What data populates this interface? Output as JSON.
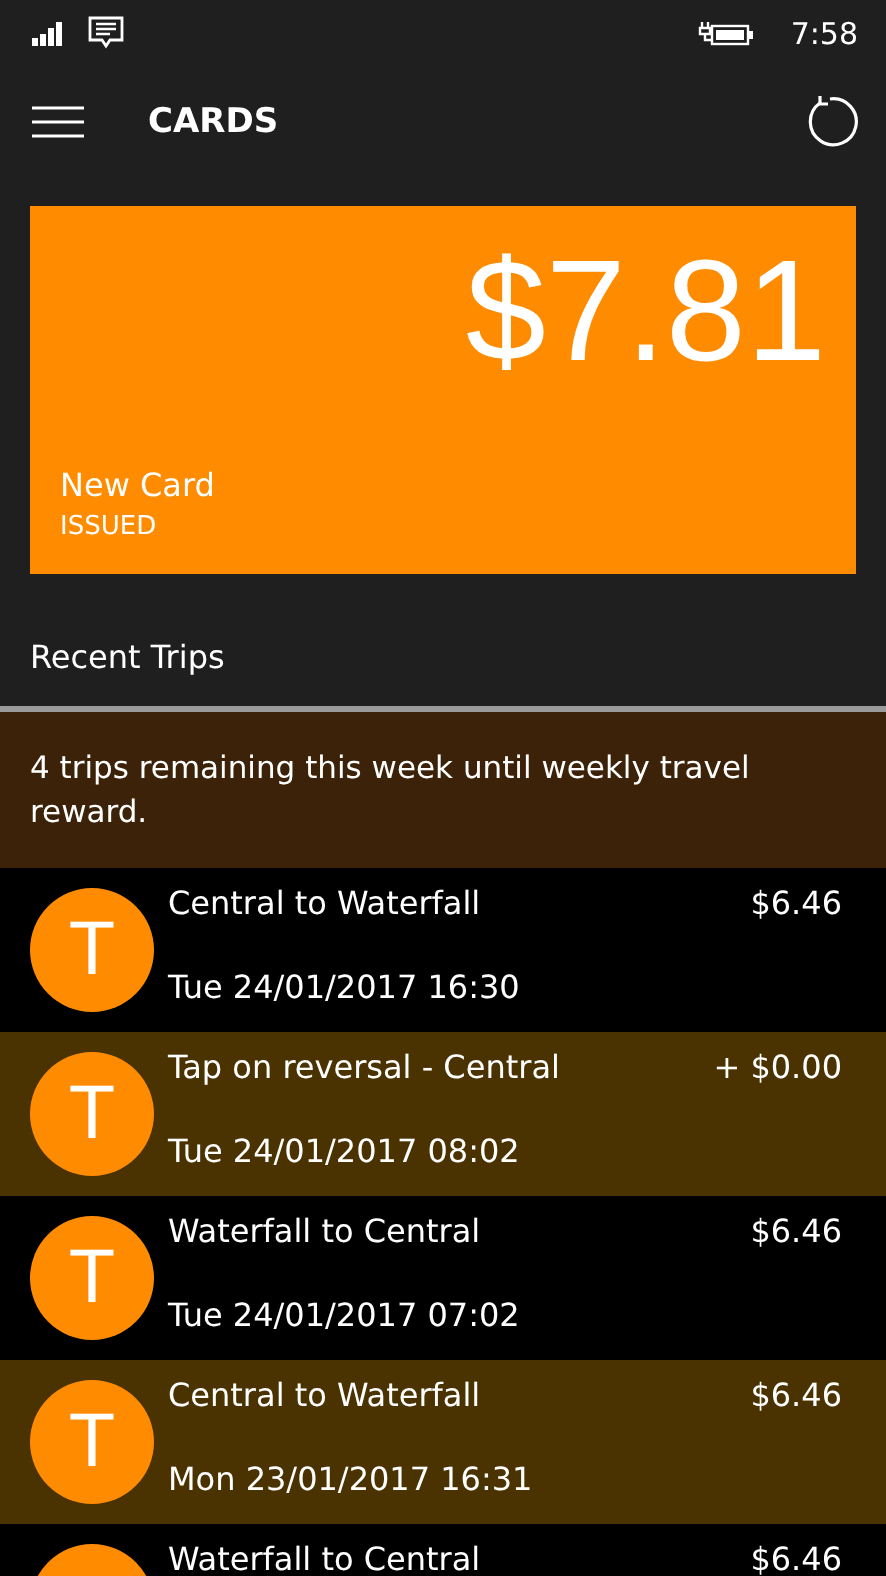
{
  "status_bar": {
    "time": "7:58"
  },
  "header": {
    "title": "CARDS"
  },
  "card": {
    "balance": "$7.81",
    "name": "New Card",
    "status": "ISSUED"
  },
  "section_title": "Recent Trips",
  "reward_banner": "4 trips remaining this week until weekly travel reward.",
  "trips": [
    {
      "avatar": "T",
      "title": "Central to Waterfall",
      "amount": "$6.46",
      "time": "Tue 24/01/2017 16:30"
    },
    {
      "avatar": "T",
      "title": "Tap on reversal - Central",
      "amount": "+ $0.00",
      "time": "Tue 24/01/2017 08:02"
    },
    {
      "avatar": "T",
      "title": "Waterfall to Central",
      "amount": "$6.46",
      "time": "Tue 24/01/2017 07:02"
    },
    {
      "avatar": "T",
      "title": "Central to Waterfall",
      "amount": "$6.46",
      "time": "Mon 23/01/2017 16:31"
    },
    {
      "title": "Waterfall to Central",
      "amount": "$6.46"
    }
  ]
}
